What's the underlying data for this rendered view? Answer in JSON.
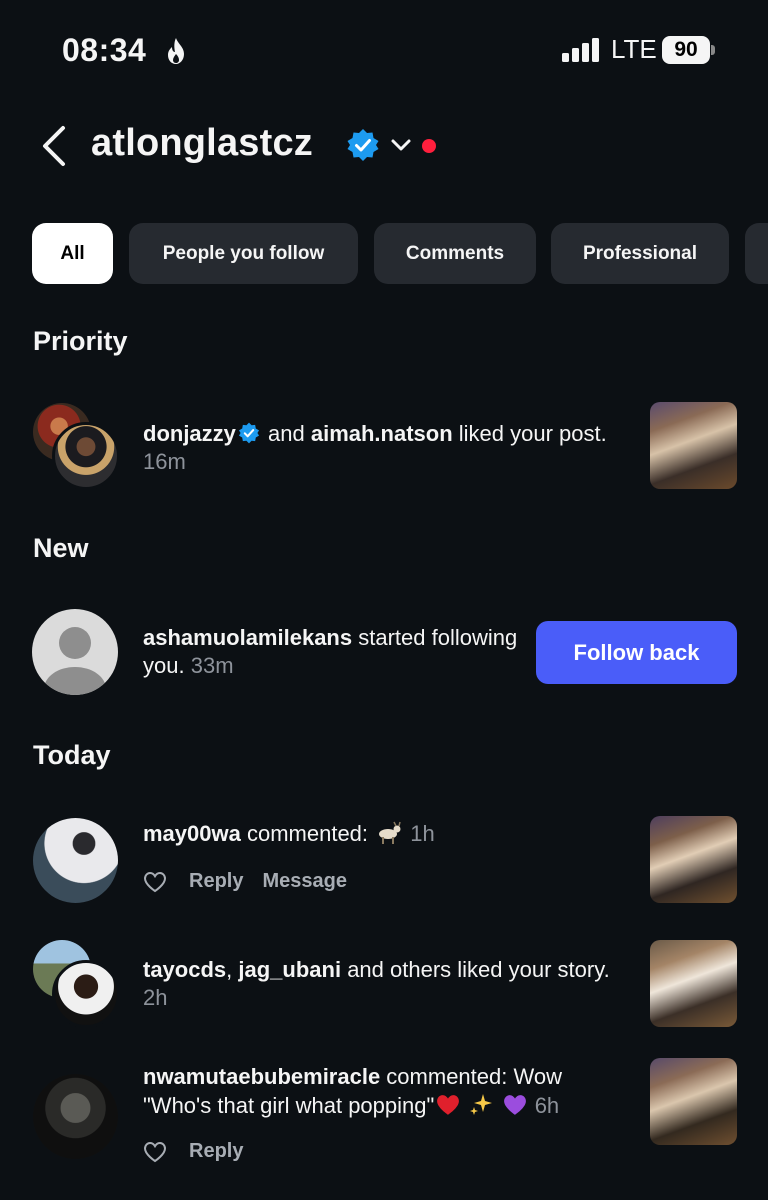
{
  "status_bar": {
    "time": "08:34",
    "network": "LTE",
    "battery": "90"
  },
  "header": {
    "username": "atlonglastcz"
  },
  "filters": [
    "All",
    "People you follow",
    "Comments",
    "Professional"
  ],
  "sections": {
    "priority": "Priority",
    "new": "New",
    "today": "Today"
  },
  "notifications": {
    "n1": {
      "user1": "donjazzy",
      "joiner": " and ",
      "user2": "aimah.natson",
      "text": " liked your post.",
      "time": "16m"
    },
    "n2": {
      "user": "ashamuolamilekans",
      "text": " started following you.",
      "time": "33m",
      "button": "Follow back"
    },
    "n3": {
      "user": "may00wa",
      "text": " commented: ",
      "time": "1h",
      "reply": "Reply",
      "message": "Message"
    },
    "n4": {
      "user1": "tayocds",
      "sep": ", ",
      "user2": "jag_ubani",
      "text": " and others liked your story.",
      "time": "2h"
    },
    "n5": {
      "user": "nwamutaebubemiracle",
      "text": " commented: Wow \"Who's that girl what popping\"",
      "time": "6h",
      "reply": "Reply"
    }
  },
  "colors": {
    "background": "#0c1014",
    "accent": "#4a5df9",
    "verified": "#1d9bf0",
    "unread_dot": "#ff1f3d"
  },
  "icons": [
    "flame-icon",
    "signal-icon",
    "battery-icon",
    "back-arrow-icon",
    "verified-badge-icon",
    "chevron-down-icon",
    "heart-icon",
    "goat-emoji",
    "sparkles-emoji",
    "heart-emoji"
  ]
}
